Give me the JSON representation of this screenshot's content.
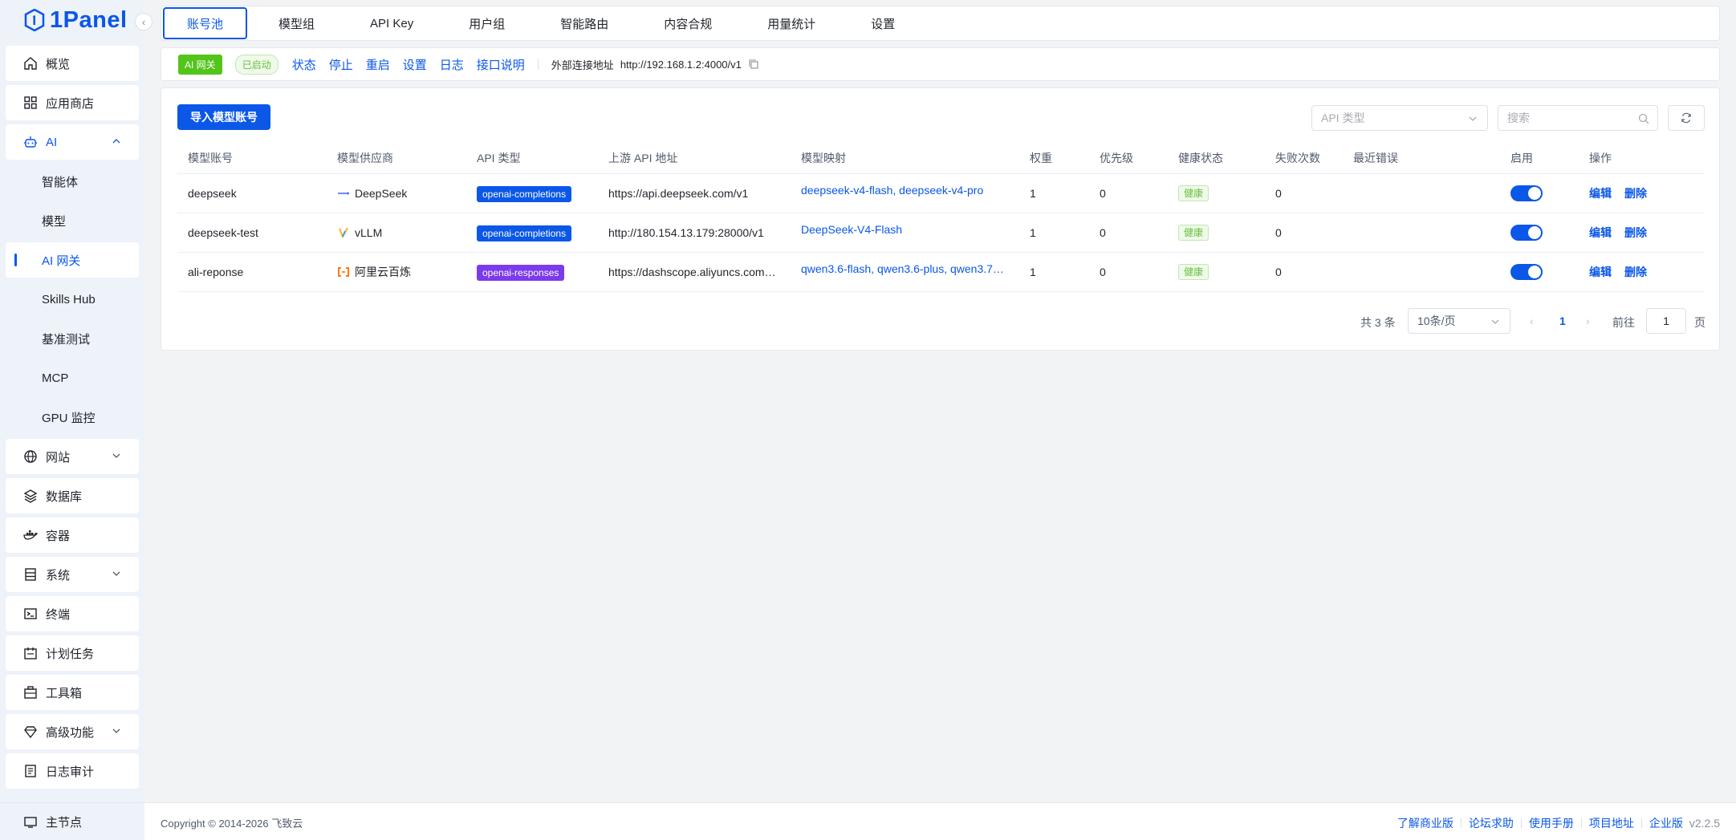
{
  "app": {
    "logo_text": "1Panel"
  },
  "sidebar": {
    "items": [
      {
        "label": "概览",
        "icon": "home-icon"
      },
      {
        "label": "应用商店",
        "icon": "grid-icon"
      },
      {
        "label": "AI",
        "icon": "robot-icon"
      },
      {
        "label": "智能体"
      },
      {
        "label": "模型"
      },
      {
        "label": "AI 网关"
      },
      {
        "label": "Skills Hub"
      },
      {
        "label": "基准测试"
      },
      {
        "label": "MCP"
      },
      {
        "label": "GPU 监控"
      },
      {
        "label": "网站",
        "icon": "globe-icon"
      },
      {
        "label": "数据库",
        "icon": "layers-icon"
      },
      {
        "label": "容器",
        "icon": "docker-icon"
      },
      {
        "label": "系统",
        "icon": "server-icon"
      },
      {
        "label": "终端",
        "icon": "terminal-icon"
      },
      {
        "label": "计划任务",
        "icon": "calendar-icon"
      },
      {
        "label": "工具箱",
        "icon": "toolbox-icon"
      },
      {
        "label": "高级功能",
        "icon": "diamond-icon"
      },
      {
        "label": "日志审计",
        "icon": "log-icon"
      }
    ],
    "node": {
      "label": "主节点",
      "icon": "node-icon"
    }
  },
  "tabs": [
    "账号池",
    "模型组",
    "API Key",
    "用户组",
    "智能路由",
    "内容合规",
    "用量统计",
    "设置"
  ],
  "status_bar": {
    "app_tag": "AI 网关",
    "status": "已启动",
    "actions": [
      "状态",
      "停止",
      "重启",
      "设置",
      "日志",
      "接口说明"
    ],
    "ext_label": "外部连接地址",
    "ext_url": "http://192.168.1.2:4000/v1"
  },
  "toolbar": {
    "import_label": "导入模型账号",
    "api_type_placeholder": "API 类型",
    "search_placeholder": "搜索"
  },
  "table": {
    "headers": [
      "模型账号",
      "模型供应商",
      "API 类型",
      "上游 API 地址",
      "模型映射",
      "权重",
      "优先级",
      "健康状态",
      "失败次数",
      "最近错误",
      "启用",
      "操作"
    ],
    "rows": [
      {
        "account": "deepseek",
        "provider": "DeepSeek",
        "provider_icon": "deepseek-icon",
        "api_type": "openai-completions",
        "api_color": "#0a57e8",
        "upstream": "https://api.deepseek.com/v1",
        "mapping": "deepseek-v4-flash, deepseek-v4-pro",
        "weight": "1",
        "priority": "0",
        "health": "健康",
        "failures": "0",
        "last_error": "",
        "enabled": true
      },
      {
        "account": "deepseek-test",
        "provider": "vLLM",
        "provider_icon": "vllm-icon",
        "api_type": "openai-completions",
        "api_color": "#0a57e8",
        "upstream": "http://180.154.13.179:28000/v1",
        "mapping": "DeepSeek-V4-Flash",
        "weight": "1",
        "priority": "0",
        "health": "健康",
        "failures": "0",
        "last_error": "",
        "enabled": true
      },
      {
        "account": "ali-reponse",
        "provider": "阿里云百炼",
        "provider_icon": "aliyun-icon",
        "api_type": "openai-responses",
        "api_color": "#7c3aed",
        "upstream": "https://dashscope.aliyuncs.com…",
        "mapping": "qwen3.6-flash, qwen3.6-plus, qwen3.7…",
        "weight": "1",
        "priority": "0",
        "health": "健康",
        "failures": "0",
        "last_error": "",
        "enabled": true
      }
    ],
    "edit_label": "编辑",
    "delete_label": "删除"
  },
  "pagination": {
    "total": "共 3 条",
    "page_size": "10条/页",
    "current": "1",
    "goto_label": "前往",
    "goto_value": "1",
    "page_label": "页"
  },
  "footer": {
    "copyright": "Copyright © 2014-2026 飞致云",
    "links": [
      "了解商业版",
      "论坛求助",
      "使用手册",
      "项目地址",
      "企业版"
    ],
    "version": "v2.2.5"
  }
}
